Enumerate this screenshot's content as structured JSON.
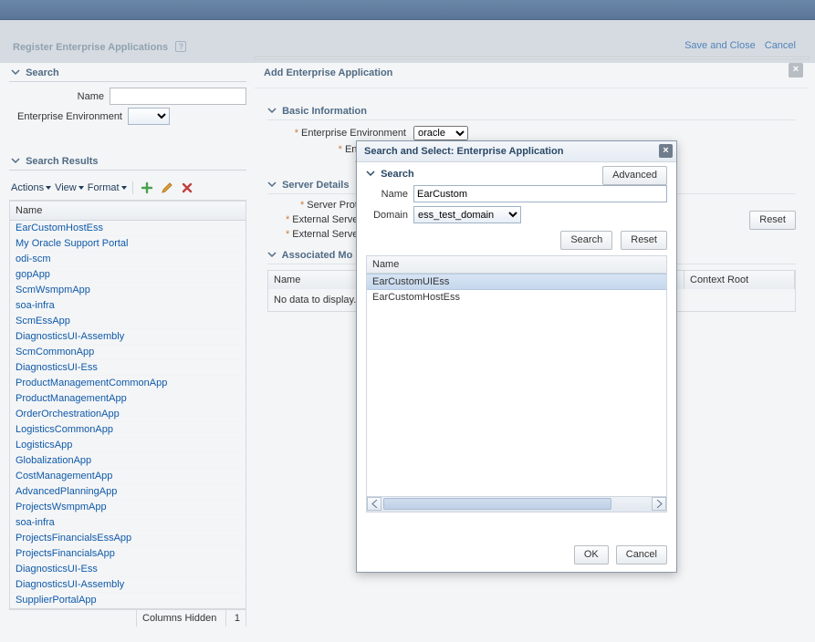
{
  "page": {
    "title": "Register Enterprise Applications"
  },
  "search": {
    "header": "Search",
    "name_label": "Name",
    "name_value": "",
    "env_label": "Enterprise Environment"
  },
  "results": {
    "header": "Search Results",
    "toolbar": {
      "actions": "Actions",
      "view": "View",
      "format": "Format"
    },
    "col_name": "Name",
    "rows": [
      "EarCustomHostEss",
      "My Oracle Support Portal",
      "odi-scm",
      "gopApp",
      "ScmWsmpmApp",
      "soa-infra",
      "ScmEssApp",
      "DiagnosticsUI-Assembly",
      "ScmCommonApp",
      "DiagnosticsUI-Ess",
      "ProductManagementCommonApp",
      "ProductManagementApp",
      "OrderOrchestrationApp",
      "LogisticsCommonApp",
      "LogisticsApp",
      "GlobalizationApp",
      "CostManagementApp",
      "AdvancedPlanningApp",
      "ProjectsWsmpmApp",
      "soa-infra",
      "ProjectsFinancialsEssApp",
      "ProjectsFinancialsApp",
      "DiagnosticsUI-Ess",
      "DiagnosticsUI-Assembly",
      "SupplierPortalApp"
    ],
    "status_label": "Columns Hidden",
    "status_count": "1"
  },
  "panel": {
    "title": "Add Enterprise Application",
    "basic_header": "Basic Information",
    "env_label": "Enterprise Environment",
    "env_value": "oracle",
    "app_label": "Enterprise Appli",
    "server_header": "Server Details",
    "server_proto": "Server Proto",
    "ext_host": "External Server H",
    "ext_port": "External Server P",
    "assoc_header": "Associated Mo",
    "assoc_col_name": "Name",
    "assoc_col_context": "Context Root",
    "no_data": "No data to display.",
    "reset": "Reset",
    "save_close": "Save and Close",
    "cancel": "Cancel"
  },
  "modal": {
    "title": "Search and Select: Enterprise Application",
    "search_header": "Search",
    "advanced": "Advanced",
    "name_label": "Name",
    "name_value": "EarCustom",
    "domain_label": "Domain",
    "domain_value": "ess_test_domain",
    "search_btn": "Search",
    "reset_btn": "Reset",
    "result_col": "Name",
    "result_rows": [
      "EarCustomUIEss",
      "EarCustomHostEss"
    ],
    "ok": "OK",
    "cancel": "Cancel"
  }
}
